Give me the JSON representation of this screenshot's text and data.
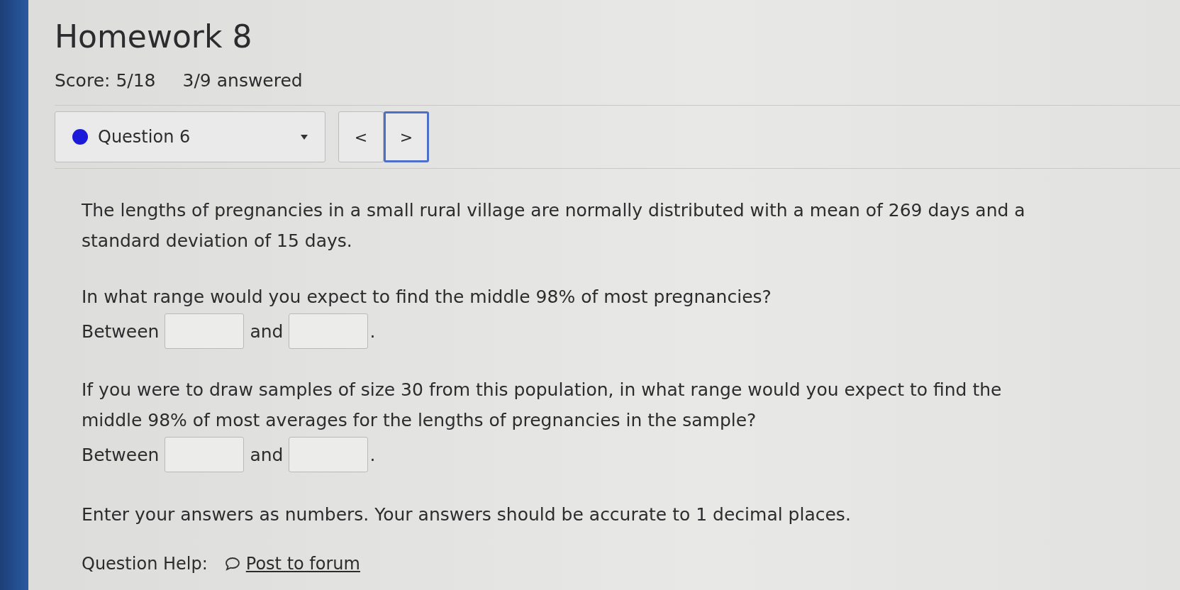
{
  "title": "Homework 8",
  "score": "Score: 5/18",
  "answered": "3/9 answered",
  "question_select": {
    "label": "Question 6",
    "color": "#1a1ad8"
  },
  "nav_buttons": [
    {
      "label": "<",
      "focused": false
    },
    {
      "label": ">",
      "focused": true
    }
  ],
  "blocks": [
    {
      "kind": "text",
      "text": "The lengths of pregnancies in a small rural village are normally distributed with a mean of 269 days and a standard deviation of 15 days."
    },
    {
      "kind": "question",
      "text": "In what range would you expect to find the middle 98% of most pregnancies?",
      "between": "Between",
      "and": "and",
      "end": "."
    },
    {
      "kind": "question",
      "text": "If you were to draw samples of size 30 from this population, in what range would you expect to find the middle 98% of most averages for the lengths of pregnancies in the sample?",
      "between": "Between",
      "and": "and",
      "end": "."
    },
    {
      "kind": "text",
      "text": "Enter your answers as numbers. Your answers should be accurate to 1 decimal places."
    }
  ],
  "help": {
    "label": "Question Help:",
    "link": "Post to forum"
  }
}
